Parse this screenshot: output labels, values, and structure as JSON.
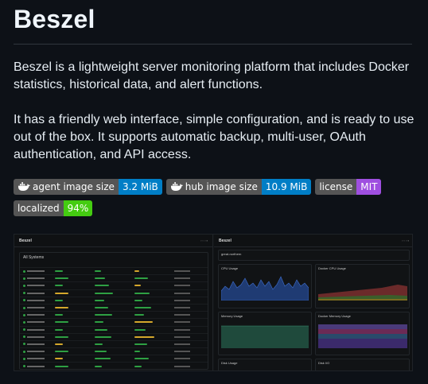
{
  "title": "Beszel",
  "paragraphs": [
    "Beszel is a lightweight server monitoring platform that includes Docker statistics, historical data, and alert functions.",
    "It has a friendly web interface, simple configuration, and is ready to use out of the box. It supports automatic backup, multi-user, OAuth authentication, and API access."
  ],
  "badges": [
    {
      "label": "agent image size",
      "value": "3.2 MiB",
      "color": "#007ec6",
      "icon": "docker-whale-icon"
    },
    {
      "label": "hub image size",
      "value": "10.9 MiB",
      "color": "#007ec6",
      "icon": "docker-whale-icon"
    },
    {
      "label": "license",
      "value": "MIT",
      "color": "#9f4fe0"
    },
    {
      "label": "localized",
      "value": "94%",
      "color": "#4c1"
    }
  ],
  "screenshot": {
    "left": {
      "brand": "Beszel",
      "panel_title": "All Systems",
      "row_count": 14
    },
    "right": {
      "brand": "Beszel",
      "host": "great-northern",
      "charts": [
        "CPU Usage",
        "Docker CPU Usage",
        "Memory Usage",
        "Docker Memory Usage",
        "Disk Usage",
        "Disk I/O"
      ]
    }
  }
}
